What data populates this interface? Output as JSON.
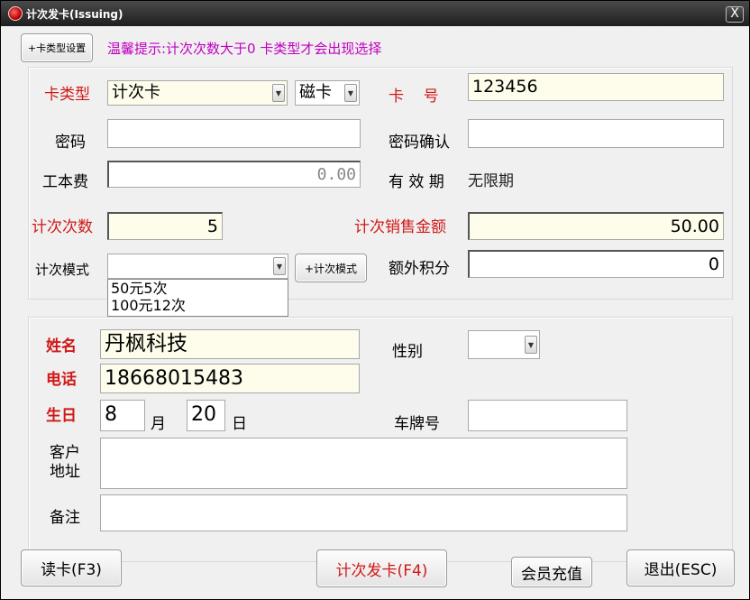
{
  "window": {
    "title": "计次发卡(Issuing)",
    "close_label": "X"
  },
  "toolbar": {
    "card_type_settings": "+卡类型设置",
    "hint": "温馨提示:计次次数大于0 卡类型才会出现选择"
  },
  "card": {
    "card_type_label": "卡类型",
    "card_type_value": "计次卡",
    "media_value": "磁卡",
    "card_no_label": "卡    号",
    "card_no_value": "123456",
    "password_label": "密码",
    "password_value": "",
    "password_confirm_label": "密码确认",
    "password_confirm_value": "",
    "fee_label": "工本费",
    "fee_value": "0.00",
    "validity_label": "有 效 期",
    "validity_value": "无限期",
    "count_label": "计次次数",
    "count_value": "5",
    "amount_label": "计次销售金额",
    "amount_value": "50.00",
    "mode_label": "计次模式",
    "mode_value": "",
    "mode_add_button": "+计次模式",
    "mode_options": [
      "50元5次",
      "100元12次"
    ],
    "points_label": "额外积分",
    "points_value": "0"
  },
  "member": {
    "name_label": "姓名",
    "name_value": "丹枫科技",
    "gender_label": "性别",
    "gender_value": "",
    "phone_label": "电话",
    "phone_value": "18668015483",
    "birthday_label": "生日",
    "birth_month": "8",
    "month_unit": "月",
    "birth_day": "20",
    "day_unit": "日",
    "plate_label": "车牌号",
    "plate_value": "",
    "address_label_1": "客户",
    "address_label_2": "地址",
    "address_value": "",
    "remark_label": "备注",
    "remark_value": ""
  },
  "footer": {
    "read_card": "读卡(F3)",
    "issue_card": "计次发卡(F4)",
    "recharge": "会员充值",
    "exit": "退出(ESC)"
  },
  "colors": {
    "required": "#d01818",
    "hint": "#c000c0",
    "cream": "#fefdec"
  }
}
